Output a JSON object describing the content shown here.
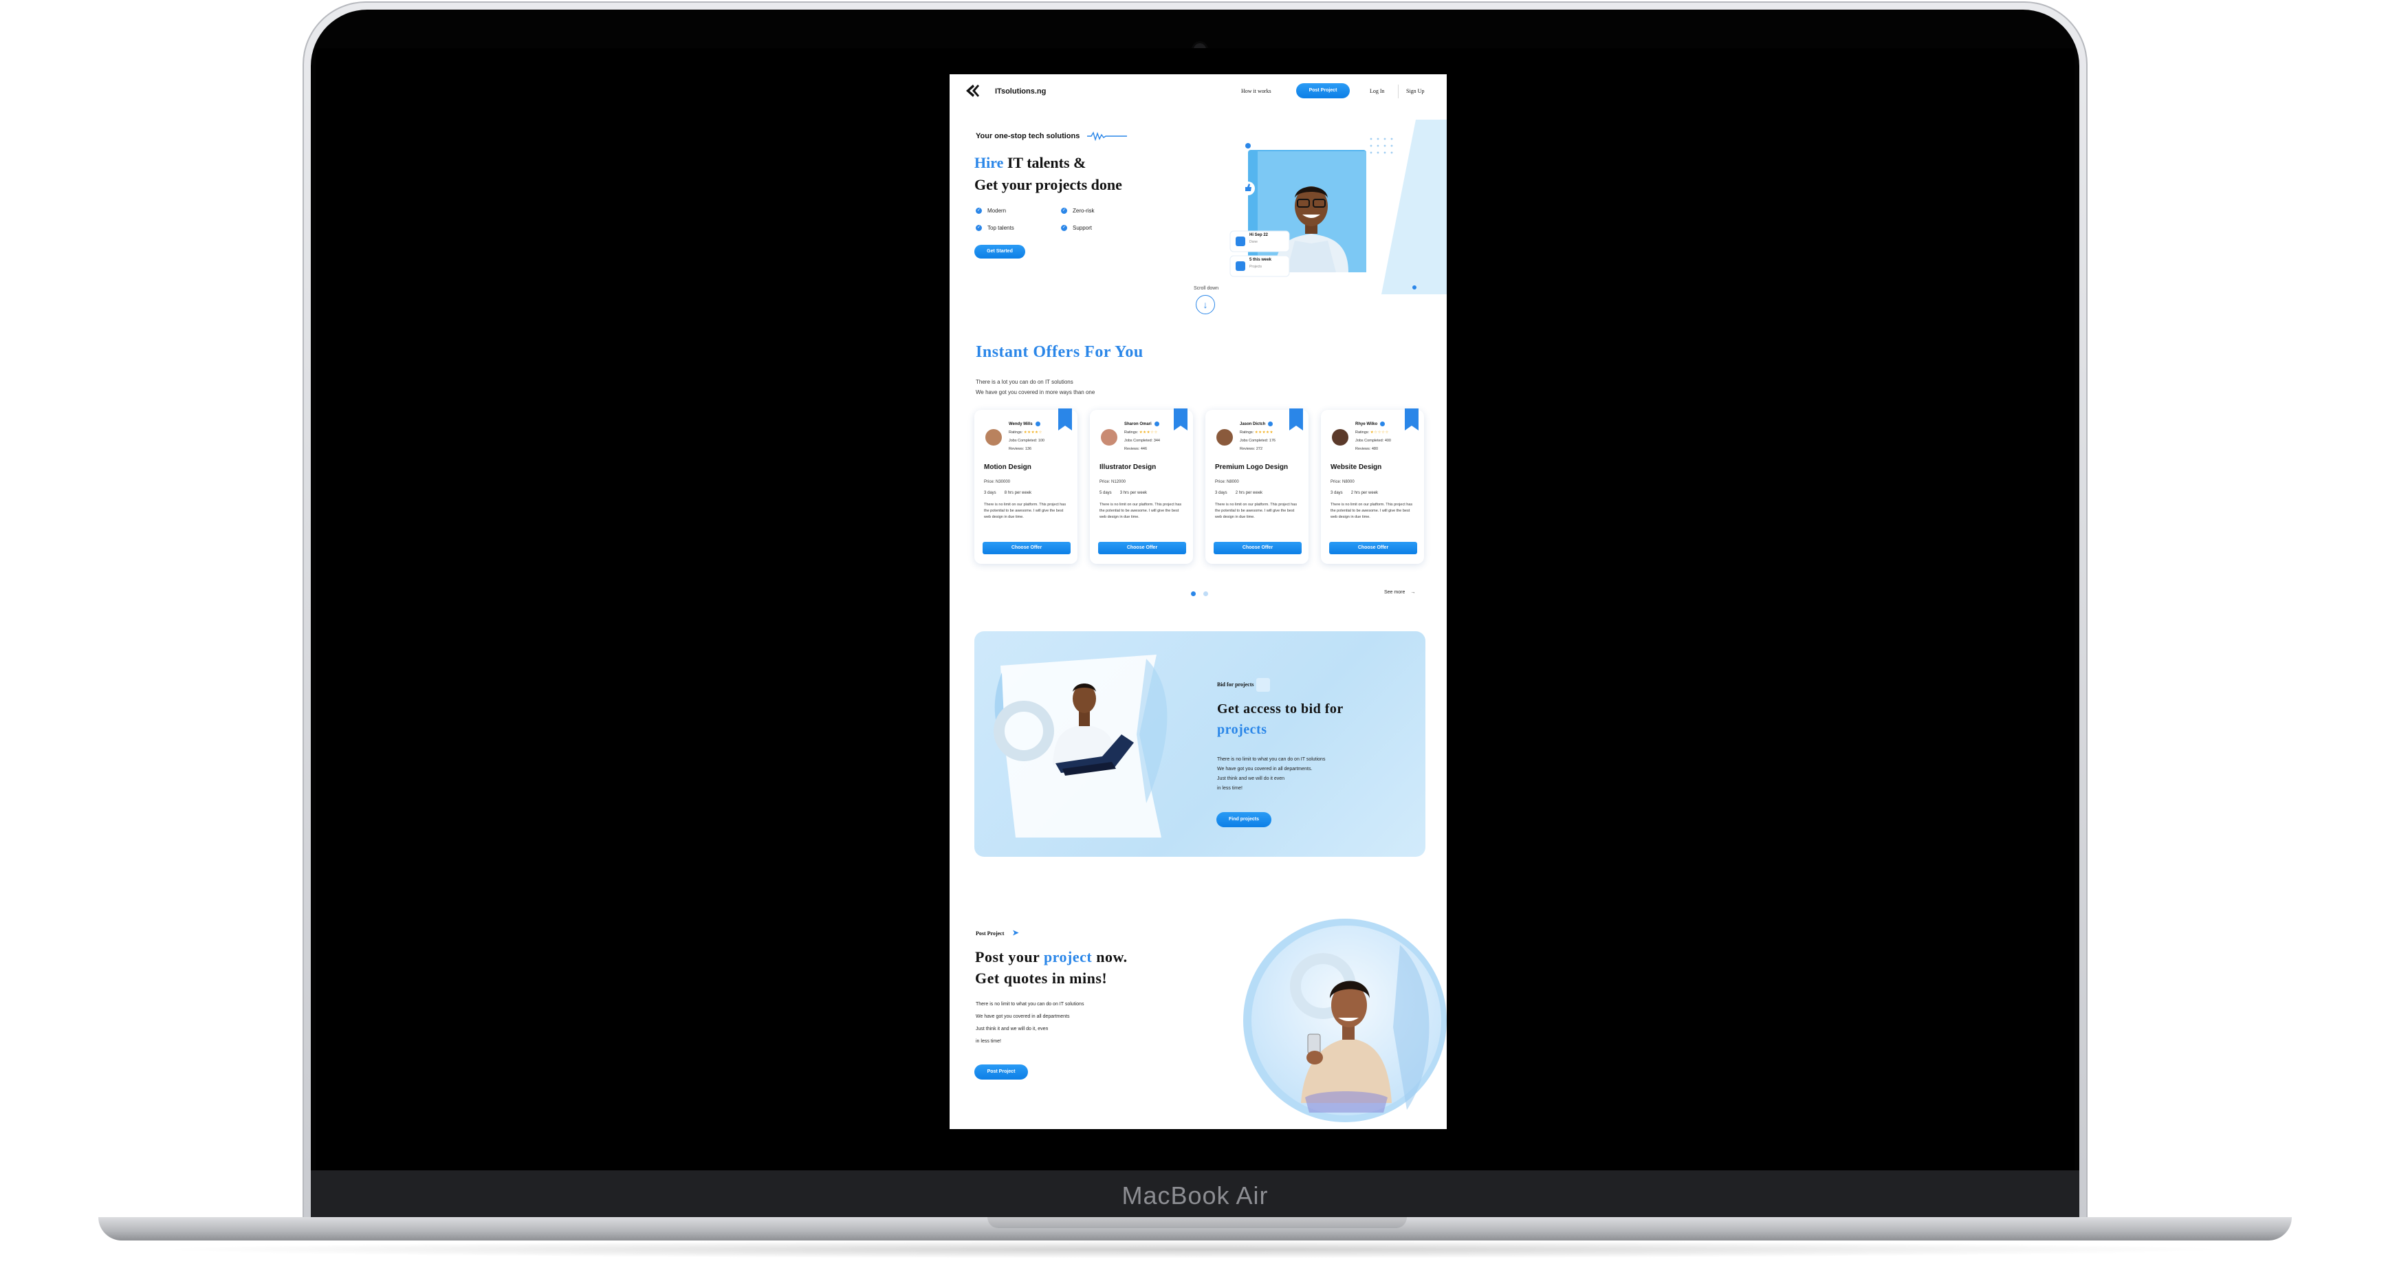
{
  "device": {
    "label": "MacBook Air"
  },
  "nav": {
    "brand": "ITsolutions.ng",
    "how_it_works": "How it works",
    "post_project": "Post Project",
    "log_in": "Log In",
    "sign_up": "Sign Up"
  },
  "hero": {
    "tagline": "Your one-stop tech solutions",
    "title_accent": "Hire",
    "title_rest": " IT talents &",
    "title_line2": "Get your projects done",
    "features": [
      "Modern",
      "Zero-risk",
      "Top talents",
      "Support"
    ],
    "cta": "Get Started",
    "stat1_title": "Hi Sep 22",
    "stat1_sub": "Done",
    "stat2_title": "5 this week",
    "stat2_sub": "Projects",
    "scroll_label": "Scroll down",
    "scroll_icon": "arrow-down-icon"
  },
  "offers": {
    "title": "Instant Offers For You",
    "subtitle_line1": "There is a lot you can do on IT solutions",
    "subtitle_line2": "We have got you covered in more ways than one",
    "ratings_label": "Ratings:",
    "jobs_label": "Jobs Completed:",
    "reviews_label": "Reviews:",
    "cta": "Choose Offer",
    "see_more": "See more",
    "cards": [
      {
        "name": "Wendy Mills",
        "jobs": "100",
        "reviews": "136",
        "rating": 4,
        "title": "Motion Design",
        "price": "Price: N30000",
        "days": "3 days",
        "hours": "8 hrs per week",
        "desc": "There is no limit on our platform. This project has the potential to be awesome. I will give the best web design in due time.",
        "avatar_color": "#b9825e"
      },
      {
        "name": "Sharon Omari",
        "jobs": "344",
        "reviews": "446",
        "rating": 3,
        "title": "Illustrator Design",
        "price": "Price: N12000",
        "days": "5 days",
        "hours": "3 hrs per week",
        "desc": "There is no limit on our platform. This project has the potential to be awesome. I will give the best web design in due time.",
        "avatar_color": "#c98b73"
      },
      {
        "name": "Jason Dictch",
        "jobs": "176",
        "reviews": "272",
        "rating": 5,
        "title": "Premium Logo Design",
        "price": "Price: N8000",
        "days": "3 days",
        "hours": "2 hrs per week",
        "desc": "There is no limit on our platform. This project has the potential to be awesome. I will give the best web design in due time.",
        "avatar_color": "#8a5a3c"
      },
      {
        "name": "Rhye Wilko",
        "jobs": "400",
        "reviews": "480",
        "rating": 1,
        "title": "Website Design",
        "price": "Price: N8000",
        "days": "3 days",
        "hours": "2 hrs per week",
        "desc": "There is no limit on our platform. This project has the potential to be awesome. I will give the best web design in due time.",
        "avatar_color": "#5b3a2a"
      }
    ],
    "pager": {
      "pages": 2,
      "current": 1
    }
  },
  "bid": {
    "label": "Bid for projects",
    "title_line1": "Get access to bid for",
    "title_accent": "projects",
    "text_lines": [
      "There is no limit to what you can do on IT solutions",
      "We have got you covered in all departments.",
      "Just think and we will do it even",
      "in less time!"
    ],
    "cta": "Find projects"
  },
  "post": {
    "label": "Post Project",
    "title_pre": "Post your ",
    "title_accent": "project",
    "title_post": " now.",
    "title_line2": "Get quotes in mins!",
    "text_lines": [
      "There is no limit to what you can do on IT solutions",
      "We have got you covered in all departments",
      "Just think it and we will do it, even",
      "in less time!"
    ],
    "cta": "Post Project"
  },
  "colors": {
    "accent": "#2a86e8",
    "panel": "#cfe9fb",
    "star": "#f2b01e"
  }
}
